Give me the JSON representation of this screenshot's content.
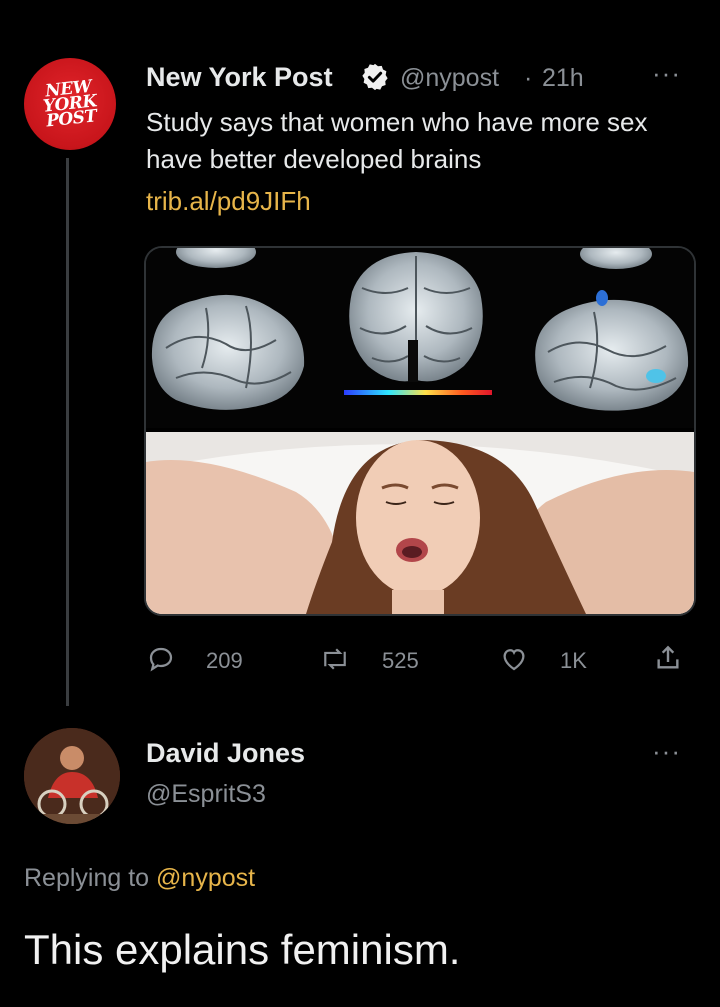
{
  "tweet": {
    "avatar_logo": "NEW YORK POST",
    "author_name": "New York Post",
    "handle": "@nypost",
    "separator": "·",
    "time": "21h",
    "more": "···",
    "text": "Study says that women who have more sex have better developed brains",
    "link": "trib.al/pd9JIFh",
    "counts": {
      "replies": "209",
      "retweets": "525",
      "likes": "1K"
    }
  },
  "reply": {
    "author_name": "David Jones",
    "handle": "@EspritS3",
    "more": "···",
    "replying_prefix": "Replying to",
    "replying_mention": "@nypost",
    "text": "This explains feminism."
  },
  "colors": {
    "background": "#000000",
    "text": "#e7e9ea",
    "muted": "#8b9096",
    "link": "#e7b54a",
    "brand_red": "#d81e24",
    "verified": "#ffffff"
  }
}
